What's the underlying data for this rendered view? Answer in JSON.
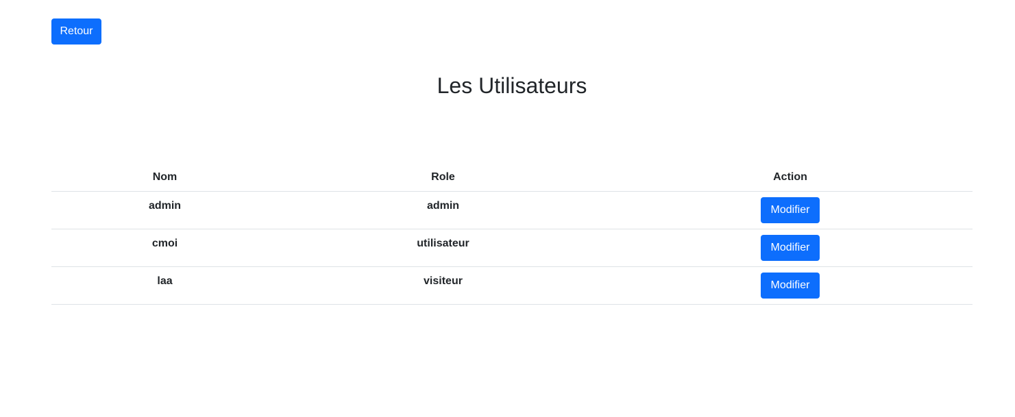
{
  "toolbar": {
    "back_label": "Retour"
  },
  "page": {
    "title": "Les Utilisateurs"
  },
  "table": {
    "headers": {
      "name": "Nom",
      "role": "Role",
      "action": "Action"
    },
    "rows": [
      {
        "name": "admin",
        "role": "admin",
        "action_label": "Modifier"
      },
      {
        "name": "cmoi",
        "role": "utilisateur",
        "action_label": "Modifier"
      },
      {
        "name": "laa",
        "role": "visiteur",
        "action_label": "Modifier"
      }
    ]
  },
  "colors": {
    "primary": "#0d6efd",
    "text": "#212529",
    "border": "#dee2e6",
    "background": "#ffffff"
  }
}
